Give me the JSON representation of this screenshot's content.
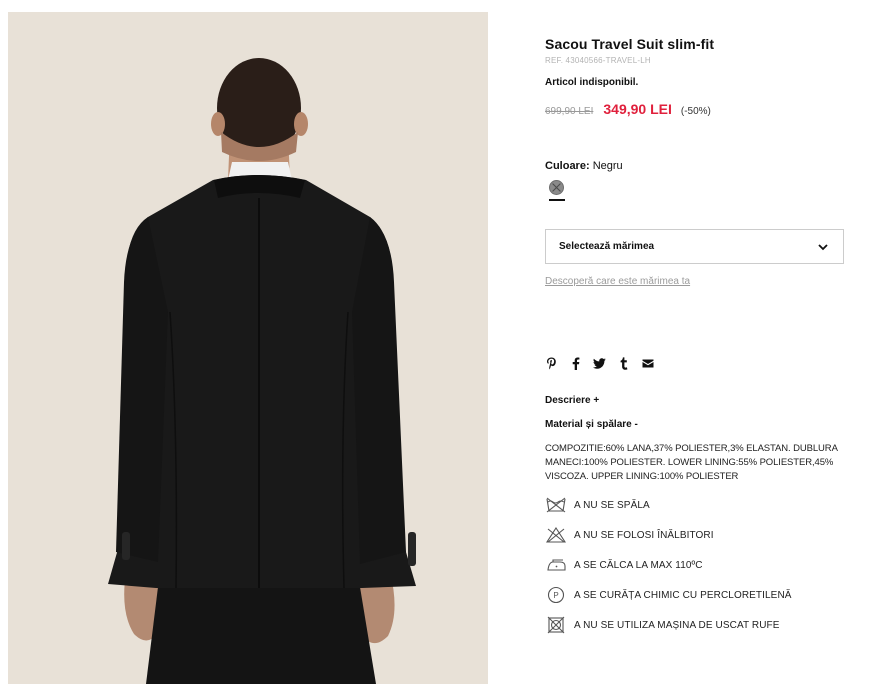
{
  "product": {
    "title": "Sacou Travel Suit slim-fit",
    "ref": "REF. 43040566-TRAVEL-LH",
    "availability": "Articol indisponibil.",
    "old_price": "699,90 LEI",
    "new_price": "349,90 LEI",
    "discount": "(-50%)"
  },
  "color": {
    "label": "Culoare:",
    "value": "Negru",
    "swatch_icon": "crossed-out-swatch-icon",
    "swatch_color": "#8a8a8a"
  },
  "size": {
    "select_label": "Selectează mărimea",
    "guide_link": "Descoperă care este mărimea ta"
  },
  "social_icons": [
    "pinterest-icon",
    "facebook-icon",
    "twitter-icon",
    "tumblr-icon",
    "email-icon"
  ],
  "sections": {
    "description": "Descriere +",
    "materials": "Material și spălare -",
    "composition": "COMPOZITIE:60% LANA,37% POLIESTER,3% ELASTAN. DUBLURA MANECI:100% POLIESTER. LOWER LINING:55% POLIESTER,45% VISCOZA. UPPER LINING:100% POLIESTER"
  },
  "care": [
    {
      "icon": "no-wash-icon",
      "text": "A NU SE SPĂLA"
    },
    {
      "icon": "no-bleach-icon",
      "text": "A NU SE FOLOSI ÎNĂLBITORI"
    },
    {
      "icon": "iron-icon",
      "text": "A SE CĂLCA LA MAX 110ºC"
    },
    {
      "icon": "dry-clean-p-icon",
      "text": "A SE CURĂȚA CHIMIC CU PERCLORETILENĂ"
    },
    {
      "icon": "no-tumble-dry-icon",
      "text": "A NU SE UTILIZA MAȘINA DE USCAT RUFE"
    }
  ],
  "colors": {
    "price_accent": "#e0203c",
    "photo_background": "#e8e1d7"
  }
}
